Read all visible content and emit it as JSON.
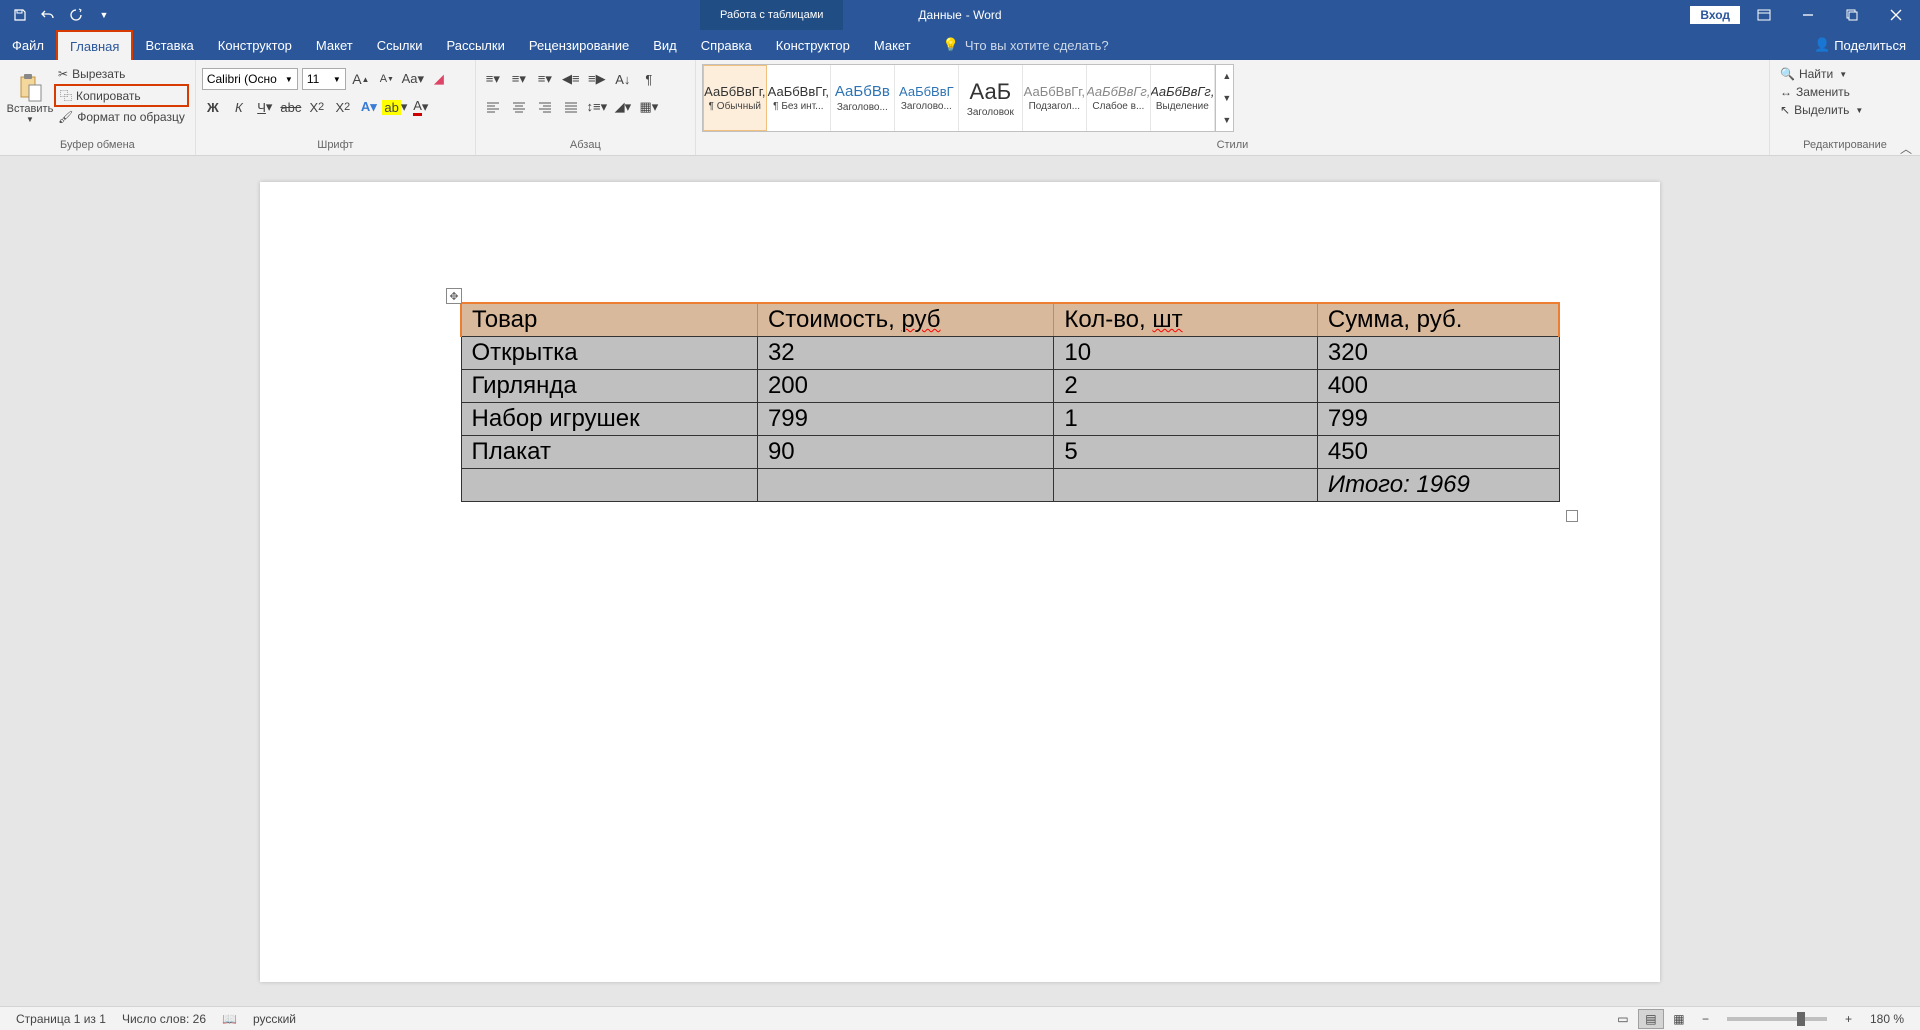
{
  "titlebar": {
    "document_name": "Данные",
    "app_suffix": " - Word",
    "table_tools": "Работа с таблицами",
    "login": "Вход"
  },
  "tabs": {
    "file": "Файл",
    "home": "Главная",
    "insert": "Вставка",
    "design": "Конструктор",
    "layout": "Макет",
    "references": "Ссылки",
    "mailings": "Рассылки",
    "review": "Рецензирование",
    "view": "Вид",
    "help": "Справка",
    "table_design": "Конструктор",
    "table_layout": "Макет",
    "tellme": "Что вы хотите сделать?",
    "share": "Поделиться"
  },
  "clipboard": {
    "paste": "Вставить",
    "cut": "Вырезать",
    "copy": "Копировать",
    "format_painter": "Формат по образцу",
    "group": "Буфер обмена"
  },
  "font": {
    "name": "Calibri (Осно",
    "size": "11",
    "group": "Шрифт"
  },
  "paragraph": {
    "group": "Абзац"
  },
  "styles": {
    "group": "Стили",
    "items": [
      {
        "preview": "АаБбВвГг,",
        "label": "¶ Обычный"
      },
      {
        "preview": "АаБбВвГг,",
        "label": "¶ Без инт..."
      },
      {
        "preview": "АаБбВв",
        "label": "Заголово..."
      },
      {
        "preview": "АаБбВвГ",
        "label": "Заголово..."
      },
      {
        "preview": "АаБ",
        "label": "Заголовок"
      },
      {
        "preview": "АаБбВвГг,",
        "label": "Подзагол..."
      },
      {
        "preview": "АаБбВвГг,",
        "label": "Слабое в..."
      },
      {
        "preview": "АаБбВвГг,",
        "label": "Выделение"
      }
    ]
  },
  "editing": {
    "find": "Найти",
    "replace": "Заменить",
    "select": "Выделить",
    "group": "Редактирование"
  },
  "table": {
    "headers": [
      "Товар",
      "Стоимость, руб",
      "Кол-во, шт",
      "Сумма, руб."
    ],
    "rows": [
      [
        "Открытка",
        "32",
        "10",
        "320"
      ],
      [
        "Гирлянда",
        "200",
        "2",
        "400"
      ],
      [
        "Набор игрушек",
        "799",
        "1",
        "799"
      ],
      [
        "Плакат",
        "90",
        "5",
        "450"
      ]
    ],
    "total": "Итого: 1969"
  },
  "statusbar": {
    "page": "Страница 1 из 1",
    "words": "Число слов: 26",
    "language": "русский",
    "zoom": "180 %"
  }
}
